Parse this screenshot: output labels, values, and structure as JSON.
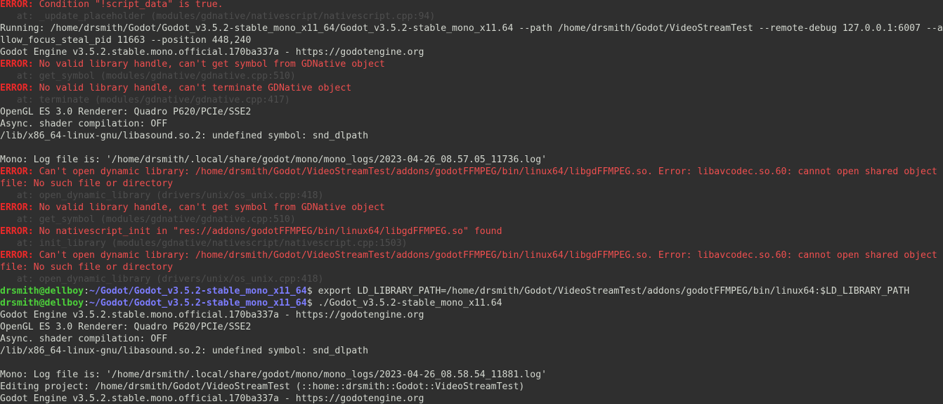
{
  "colors": {
    "background": "#2f2f2f",
    "text": "#d3d7cf",
    "error_label": "#ef2929",
    "error_message": "#ef4f4f",
    "trace": "#4e4e4e",
    "prompt_user": "#4cd13a",
    "prompt_path": "#7d7dff"
  },
  "lines": [
    {
      "type": "error",
      "label": "ERROR:",
      "text": " Condition \"!script_data\" is true."
    },
    {
      "type": "trace",
      "text": "   at: _update_placeholder (modules/gdnative/nativescript/nativescript.cpp:94)"
    },
    {
      "type": "plain",
      "text": "Running: /home/drsmith/Godot/Godot_v3.5.2-stable_mono_x11_64/Godot_v3.5.2-stable_mono_x11.64 --path /home/drsmith/Godot/VideoStreamTest --remote-debug 127.0.0.1:6007 --a"
    },
    {
      "type": "plain",
      "text": "llow_focus_steal_pid 11663 --position 448,240"
    },
    {
      "type": "plain",
      "text": "Godot Engine v3.5.2.stable.mono.official.170ba337a - https://godotengine.org"
    },
    {
      "type": "error",
      "label": "ERROR:",
      "text": " No valid library handle, can't get symbol from GDNative object"
    },
    {
      "type": "trace",
      "text": "   at: get_symbol (modules/gdnative/gdnative.cpp:510)"
    },
    {
      "type": "error",
      "label": "ERROR:",
      "text": " No valid library handle, can't terminate GDNative object"
    },
    {
      "type": "trace",
      "text": "   at: terminate (modules/gdnative/gdnative.cpp:417)"
    },
    {
      "type": "plain",
      "text": "OpenGL ES 3.0 Renderer: Quadro P620/PCIe/SSE2"
    },
    {
      "type": "plain",
      "text": "Async. shader compilation: OFF"
    },
    {
      "type": "plain",
      "text": "/lib/x86_64-linux-gnu/libasound.so.2: undefined symbol: snd_dlpath"
    },
    {
      "type": "blank",
      "text": ""
    },
    {
      "type": "plain",
      "text": "Mono: Log file is: '/home/drsmith/.local/share/godot/mono/mono_logs/2023-04-26_08.57.05_11736.log'"
    },
    {
      "type": "error",
      "label": "ERROR:",
      "text": " Can't open dynamic library: /home/drsmith/Godot/VideoStreamTest/addons/godotFFMPEG/bin/linux64/libgdFFMPEG.so. Error: libavcodec.so.60: cannot open shared object"
    },
    {
      "type": "errorcont",
      "text": "file: No such file or directory"
    },
    {
      "type": "trace",
      "text": "   at: open_dynamic_library (drivers/unix/os_unix.cpp:418)"
    },
    {
      "type": "error",
      "label": "ERROR:",
      "text": " No valid library handle, can't get symbol from GDNative object"
    },
    {
      "type": "trace",
      "text": "   at: get_symbol (modules/gdnative/gdnative.cpp:510)"
    },
    {
      "type": "error",
      "label": "ERROR:",
      "text": " No nativescript_init in \"res://addons/godotFFMPEG/bin/linux64/libgdFFMPEG.so\" found"
    },
    {
      "type": "trace",
      "text": "   at: init_library (modules/gdnative/nativescript/nativescript.cpp:1503)"
    },
    {
      "type": "error",
      "label": "ERROR:",
      "text": " Can't open dynamic library: /home/drsmith/Godot/VideoStreamTest/addons/godotFFMPEG/bin/linux64/libgdFFMPEG.so. Error: libavcodec.so.60: cannot open shared object"
    },
    {
      "type": "errorcont",
      "text": "file: No such file or directory"
    },
    {
      "type": "trace",
      "text": "   at: open_dynamic_library (drivers/unix/os_unix.cpp:418)"
    },
    {
      "type": "prompt",
      "user": "drsmith@dellboy",
      "sep": ":",
      "path": "~/Godot/Godot_v3.5.2-stable_mono_x11_64",
      "cmd": "$ export LD_LIBRARY_PATH=/home/drsmith/Godot/VideoStreamTest/addons/godotFFMPEG/bin/linux64:$LD_LIBRARY_PATH"
    },
    {
      "type": "prompt",
      "user": "drsmith@dellboy",
      "sep": ":",
      "path": "~/Godot/Godot_v3.5.2-stable_mono_x11_64",
      "cmd": "$ ./Godot_v3.5.2-stable_mono_x11.64"
    },
    {
      "type": "plain",
      "text": "Godot Engine v3.5.2.stable.mono.official.170ba337a - https://godotengine.org"
    },
    {
      "type": "plain",
      "text": "OpenGL ES 3.0 Renderer: Quadro P620/PCIe/SSE2"
    },
    {
      "type": "plain",
      "text": "Async. shader compilation: OFF"
    },
    {
      "type": "plain",
      "text": "/lib/x86_64-linux-gnu/libasound.so.2: undefined symbol: snd_dlpath"
    },
    {
      "type": "blank",
      "text": ""
    },
    {
      "type": "plain",
      "text": "Mono: Log file is: '/home/drsmith/.local/share/godot/mono/mono_logs/2023-04-26_08.58.54_11881.log'"
    },
    {
      "type": "plain",
      "text": "Editing project: /home/drsmith/Godot/VideoStreamTest (::home::drsmith::Godot::VideoStreamTest)"
    },
    {
      "type": "plain",
      "text": "Godot Engine v3.5.2.stable.mono.official.170ba337a - https://godotengine.org"
    }
  ]
}
